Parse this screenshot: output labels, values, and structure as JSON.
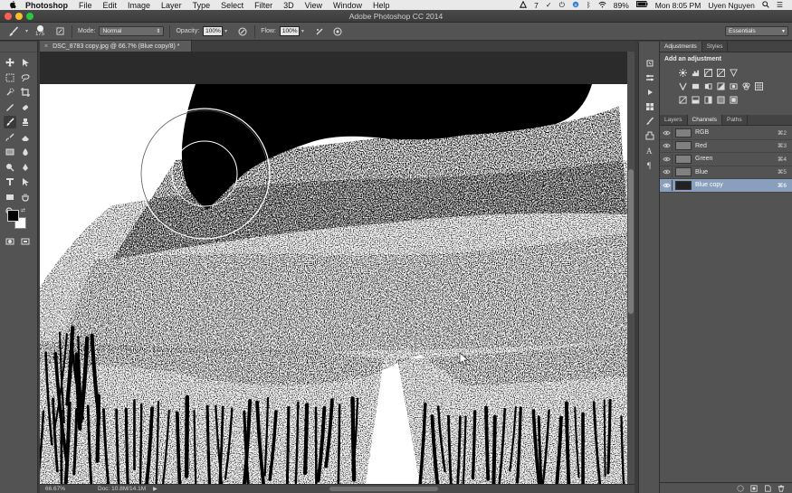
{
  "menubar": {
    "app": "Photoshop",
    "items": [
      "File",
      "Edit",
      "Image",
      "Layer",
      "Type",
      "Select",
      "Filter",
      "3D",
      "View",
      "Window",
      "Help"
    ],
    "status": {
      "adobe_badge": "7",
      "battery": "89%",
      "clock": "Mon 8:05 PM",
      "user": "Uyen Nguyen"
    }
  },
  "window": {
    "title": "Adobe Photoshop CC 2014",
    "traffic_colors": [
      "#fd5f57",
      "#fdbb2e",
      "#28c840"
    ]
  },
  "options": {
    "brush_size": "175",
    "mode_label": "Mode:",
    "mode_value": "Normal",
    "opacity_label": "Opacity:",
    "opacity_value": "100%",
    "flow_label": "Flow:",
    "flow_value": "100%",
    "workspace": "Essentials"
  },
  "document": {
    "tab_title": "DSC_8783 copy.jpg @ 66.7% (Blue copy/8) *",
    "zoom": "66.67%",
    "doc_size": "Doc: 10.8M/14.1M"
  },
  "adjustments": {
    "tabs": [
      "Adjustments",
      "Styles"
    ],
    "title": "Add an adjustment"
  },
  "channels": {
    "tabs": [
      "Layers",
      "Channels",
      "Paths"
    ],
    "rows": [
      {
        "name": "RGB",
        "key": "⌘2",
        "visible": true
      },
      {
        "name": "Red",
        "key": "⌘3",
        "visible": true
      },
      {
        "name": "Green",
        "key": "⌘4",
        "visible": true
      },
      {
        "name": "Blue",
        "key": "⌘5",
        "visible": true
      },
      {
        "name": "Blue copy",
        "key": "⌘6",
        "visible": true,
        "selected": true
      }
    ]
  },
  "colors": {
    "selection": "#8a9fbd",
    "foreground": "#000000",
    "background": "#ffffff"
  }
}
